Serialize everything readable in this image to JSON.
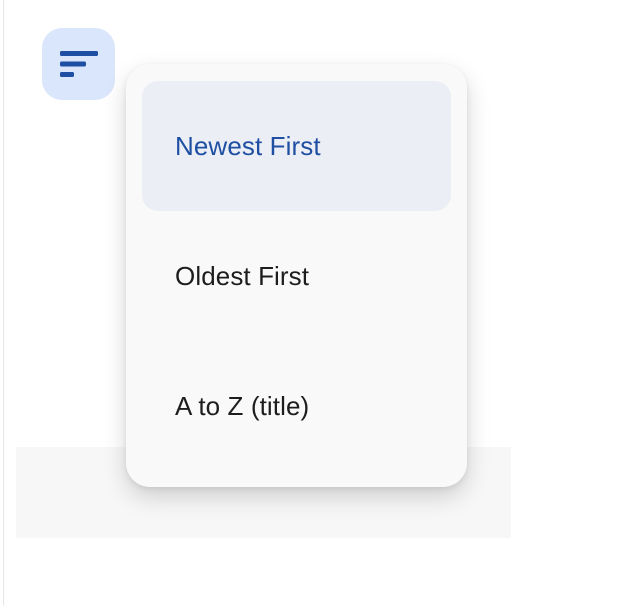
{
  "sort_button": {
    "icon": "sort-icon",
    "background": "#dae6fb",
    "icon_color": "#1f4fa3"
  },
  "sort_menu": {
    "items": [
      {
        "label": "Newest First",
        "selected": true
      },
      {
        "label": "Oldest First",
        "selected": false
      },
      {
        "label": "A to Z (title)",
        "selected": false
      }
    ]
  },
  "colors": {
    "accent": "#1f4fa3",
    "selected_background": "#ebeef4",
    "menu_background": "#f9f9f9"
  }
}
